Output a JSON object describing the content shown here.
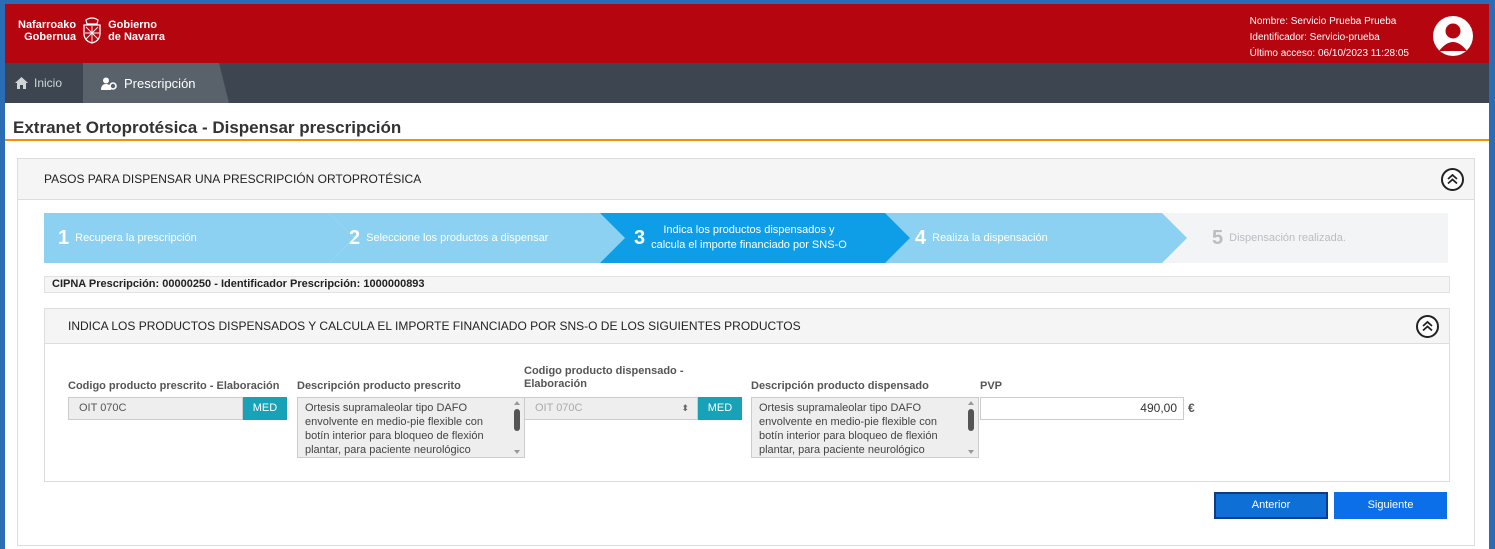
{
  "header": {
    "logo_line1_left": "Nafarroako",
    "logo_line2_left": "Gobernua",
    "logo_line1_right": "Gobierno",
    "logo_line2_right": "de Navarra",
    "user_name": "Nombre: Servicio Prueba Prueba",
    "user_id": "Identificador: Servicio-prueba",
    "last_access": "Último acceso: 06/10/2023 11:28:05"
  },
  "nav": {
    "home_label": "Inicio",
    "active_tab_label": "Prescripción"
  },
  "page_title": "Extranet Ortoprotésica - Dispensar prescripción",
  "steps_panel": {
    "title": "PASOS PARA DISPENSAR UNA PRESCRIPCIÓN ORTOPROTÉSICA",
    "steps": [
      {
        "num": "1",
        "label": "Recupera la prescripción"
      },
      {
        "num": "2",
        "label": "Seleccione los productos a dispensar"
      },
      {
        "num": "3",
        "label_line1": "Indica los productos dispensados y",
        "label_line2": "calcula el importe financiado por SNS-O"
      },
      {
        "num": "4",
        "label": "Realiza la dispensación"
      },
      {
        "num": "5",
        "label": "Dispensación realizada."
      }
    ],
    "active_step": 3,
    "cipna": "CIPNA Prescripción: 00000250 - Identificador Prescripción: 1000000893"
  },
  "products_panel": {
    "title": "INDICA LOS PRODUCTOS DISPENSADOS Y CALCULA EL IMPORTE FINANCIADO POR SNS-O DE LOS SIGUIENTES PRODUCTOS",
    "labels": {
      "prescribed_code": "Codigo producto prescrito - Elaboración",
      "prescribed_desc": "Descripción producto prescrito",
      "dispensed_code_line1": "Codigo producto dispensado -",
      "dispensed_code_line2": "Elaboración",
      "dispensed_desc": "Descripción producto dispensado",
      "pvp": "PVP"
    },
    "prescribed_code": "OIT 070C",
    "prescribed_badge": "MED",
    "prescribed_desc": "Ortesis supramaleolar tipo DAFO envolvente en medio-pie flexible con botín interior para bloqueo de flexión plantar, para paciente neurológico",
    "dispensed_code": "OIT 070C",
    "dispensed_badge": "MED",
    "dispensed_desc": "Ortesis supramaleolar tipo DAFO envolvente en medio-pie flexible con botín interior para bloqueo de flexión plantar, para paciente neurológico",
    "pvp_value": "490,00",
    "currency": "€"
  },
  "buttons": {
    "prev": "Anterior",
    "next": "Siguiente"
  },
  "colors": {
    "header_red": "#b5050f",
    "nav_dark": "#3d4650",
    "accent_orange": "#f39200",
    "step_light": "#8cd0f2",
    "step_active": "#0e9ee8",
    "badge_teal": "#17a2b8",
    "button_blue": "#0a6fe8"
  }
}
